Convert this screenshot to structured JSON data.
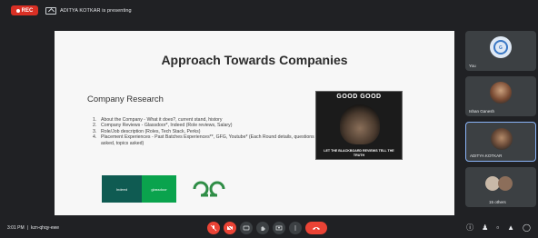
{
  "topbar": {
    "rec_label": "REC",
    "presenter_text": "ADITYA KOTKAR is presenting"
  },
  "slide": {
    "title": "Approach Towards Companies",
    "section_title": "Company Research",
    "bullets": [
      {
        "num": "1.",
        "text": "About the Company - What it does?, current stand, history"
      },
      {
        "num": "2.",
        "text": "Company Reviews - Glassdoor*, Indeed (Role reviews, Salary)"
      },
      {
        "num": "3.",
        "text": "Role/Job description (Roles, Tech Stack, Perks)"
      },
      {
        "num": "4.",
        "text": "Placement Experiences - Past Batches Experiences**, GFG, Youtube* (Each Round details, questions asked, topics asked)"
      }
    ],
    "meme_top": "GOOD GOOD",
    "meme_bottom": "LET THE BLACKBOARD REVIEWS TELL THE TRUTH",
    "logo_glassdoor": "Indeed",
    "logo_indeed": "glassdoor",
    "colors": {
      "glassdoor": "#0f5b52",
      "indeed": "#0aa34d",
      "gfg": "#2f8d46"
    }
  },
  "participants": [
    {
      "name": "You",
      "icon": "avatar-icon"
    },
    {
      "name": "Ishan Ganesh",
      "icon": "avatar-icon"
    },
    {
      "name": "ADITYA KOTKAR",
      "icon": "avatar-icon"
    },
    {
      "name": "15 others",
      "icon": "people-icon"
    }
  ],
  "bottombar": {
    "time": "3:01 PM",
    "separator": "|",
    "meeting_code": "kzn-qhqy-ewe"
  }
}
